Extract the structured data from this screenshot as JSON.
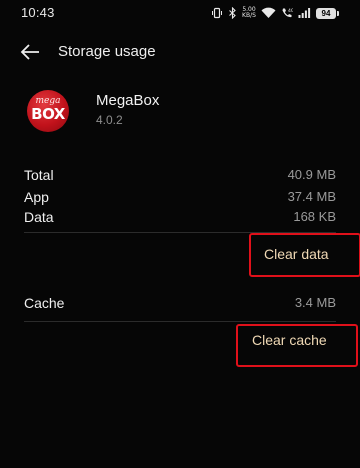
{
  "status_bar": {
    "time": "10:43",
    "network_speed_value": "5.00",
    "network_speed_unit": "KB/S",
    "battery_level": "94"
  },
  "header": {
    "title": "Storage usage"
  },
  "app": {
    "name": "MegaBox",
    "version": "4.0.2",
    "logo_text_top": "mega",
    "logo_text_bottom": "BOX"
  },
  "storage": {
    "rows": [
      {
        "label": "Total",
        "value": "40.9 MB"
      },
      {
        "label": "App",
        "value": "37.4 MB"
      },
      {
        "label": "Data",
        "value": "168 KB"
      }
    ],
    "clear_data_label": "Clear data",
    "cache": {
      "label": "Cache",
      "value": "3.4 MB"
    },
    "clear_cache_label": "Clear cache"
  },
  "colors": {
    "background": "#060606",
    "accent_text": "#f0d9b5",
    "highlight_frame": "#e0101a",
    "logo_red": "#c1121b"
  }
}
